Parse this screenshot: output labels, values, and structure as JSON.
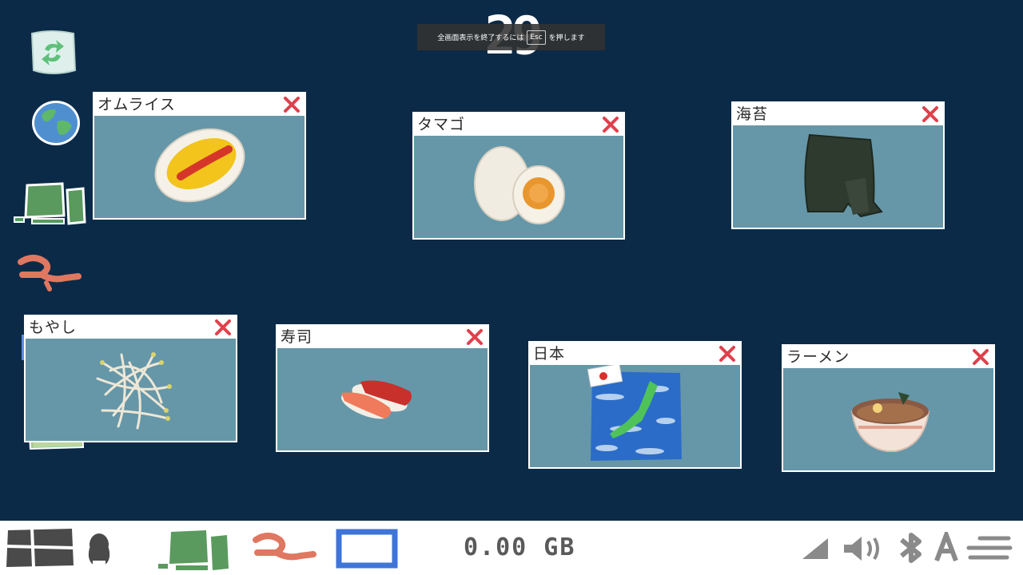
{
  "counter": {
    "value": "29"
  },
  "toast": {
    "before": "全画面表示を終了するには",
    "key": "Esc",
    "after": "を押します"
  },
  "sidebar": {
    "items": [
      {
        "name": "recycle-icon"
      },
      {
        "name": "globe-icon"
      },
      {
        "name": "computer-icon"
      },
      {
        "name": "pipe-icon"
      },
      {
        "name": "window-icon"
      },
      {
        "name": "folder-icon"
      }
    ]
  },
  "windows": [
    {
      "title": "オムライス",
      "image": "omurice"
    },
    {
      "title": "タマゴ",
      "image": "egg"
    },
    {
      "title": "海苔",
      "image": "nori"
    },
    {
      "title": "もやし",
      "image": "bean-sprouts"
    },
    {
      "title": "寿司",
      "image": "sushi"
    },
    {
      "title": "日本",
      "image": "japan-map"
    },
    {
      "title": "ラーメン",
      "image": "ramen"
    }
  ],
  "taskbar": {
    "storage": "0.00 GB",
    "left_icons": [
      "start-icon",
      "mouse-icon",
      "computer-icon",
      "pipe-icon",
      "window-icon"
    ],
    "right_icons": [
      "wifi-icon",
      "volume-icon",
      "bluetooth-icon",
      "input-language-icon",
      "menu-icon"
    ]
  },
  "colors": {
    "desktop": "#0b2a47",
    "window_content": "#6597a8",
    "close_x": "#e0404b"
  }
}
